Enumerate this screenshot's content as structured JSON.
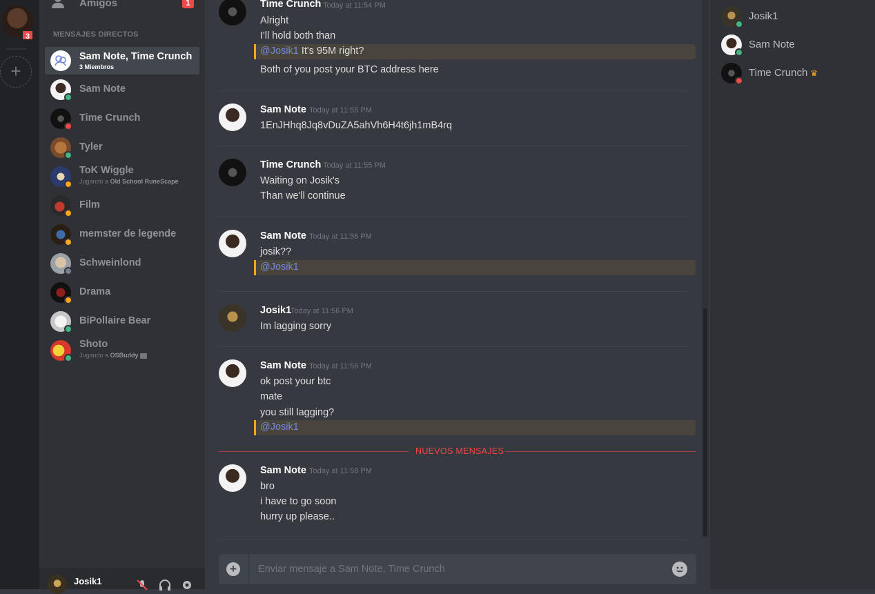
{
  "guilds": {
    "notification_badge": "3"
  },
  "dm_sidebar": {
    "friends_label": "Amigos",
    "friends_badge": "1",
    "section_header": "MENSAJES DIRECTOS",
    "items": [
      {
        "name": "Sam Note, Time Crunch",
        "sub": "3 Miembros",
        "active": true,
        "status": ""
      },
      {
        "name": "Sam Note",
        "status": "online"
      },
      {
        "name": "Time Crunch",
        "status": "dnd"
      },
      {
        "name": "Tyler",
        "status": "online"
      },
      {
        "name": "ToK Wiggle",
        "sub_prefix": "Jugando a",
        "sub_game": "Old School RuneScape",
        "status": "idle"
      },
      {
        "name": "Film",
        "status": "idle"
      },
      {
        "name": "memster de legende",
        "status": "idle"
      },
      {
        "name": "Schweinlond",
        "status": "offline"
      },
      {
        "name": "Drama",
        "status": "idle"
      },
      {
        "name": "BiPollaire Bear",
        "status": "online"
      },
      {
        "name": "Shoto",
        "sub_prefix": "Jugando a",
        "sub_game": "OSBuddy",
        "status": "online"
      }
    ]
  },
  "user_panel": {
    "username": "Josik1"
  },
  "chat": {
    "messages": [
      {
        "author": "Time Crunch",
        "time": "Today at 11:54 PM",
        "lines": [
          "Alright",
          "I'll hold both than"
        ],
        "mention": {
          "tag": "@Josik1",
          "text": " It's 95M right?"
        },
        "after": "Both of you post your BTC address here"
      },
      {
        "author": "Sam Note",
        "time": "Today at 11:55 PM",
        "lines": [
          "1EnJHhq8Jq8vDuZA5ahVh6H4t6jh1mB4rq"
        ]
      },
      {
        "author": "Time Crunch",
        "time": "Today at 11:55 PM",
        "lines": [
          "Waiting on Josik's",
          "Than we'll continue"
        ]
      },
      {
        "author": "Sam Note",
        "time": "Today at 11:56 PM",
        "lines": [
          "josik??"
        ],
        "mention": {
          "tag": "@Josik1",
          "text": ""
        }
      },
      {
        "author": "Josik1",
        "time": "Today at 11:56 PM",
        "lines": [
          "Im lagging sorry"
        ]
      },
      {
        "author": "Sam Note",
        "time": "Today at 11:56 PM",
        "lines": [
          "ok post your btc",
          "mate",
          "you still lagging?"
        ],
        "mention": {
          "tag": "@Josik1",
          "text": ""
        }
      },
      {
        "author": "Sam Note",
        "time": "Today at 11:58 PM",
        "lines": [
          "bro",
          "i have to go soon",
          "hurry up please.."
        ]
      }
    ],
    "new_messages_label": "NUEVOS MENSAJES",
    "composer_placeholder": "Enviar mensaje a Sam Note, Time Crunch"
  },
  "members": [
    {
      "name": "Josik1",
      "status": "online",
      "owner": false
    },
    {
      "name": "Sam Note",
      "status": "online",
      "owner": false
    },
    {
      "name": "Time Crunch",
      "status": "dnd",
      "owner": true
    }
  ],
  "colors": {
    "online": "#43b581",
    "dnd": "#f04747",
    "idle": "#faa61a",
    "offline": "#747f8d",
    "mention": "#7289da",
    "new_messages": "#f04747"
  }
}
